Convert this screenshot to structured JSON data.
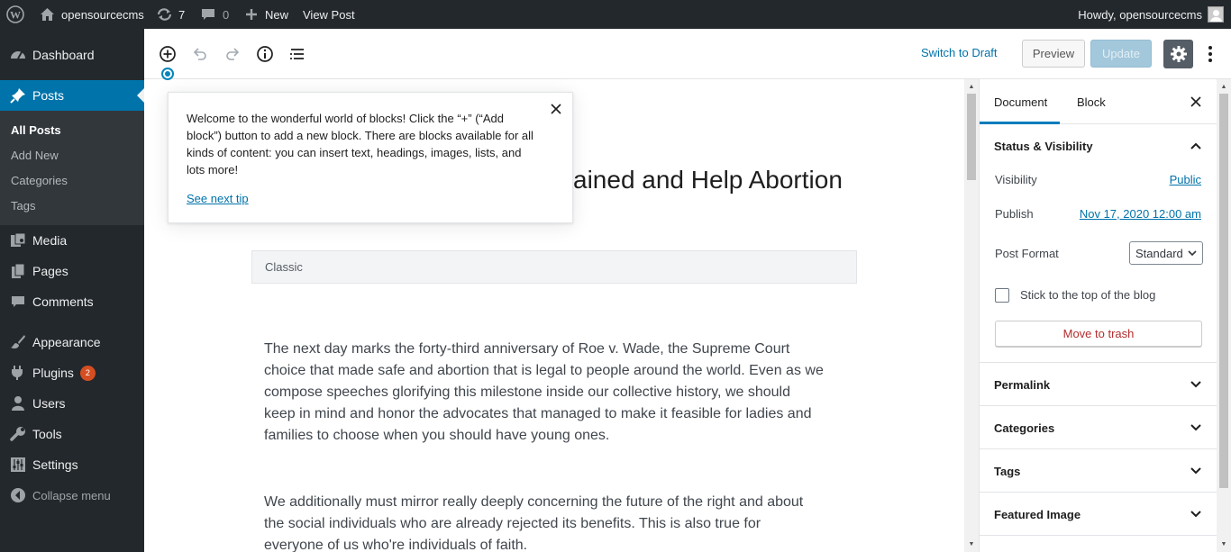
{
  "admin_bar": {
    "site_name": "opensourcecms",
    "updates_count": "7",
    "comments_count": "0",
    "new_label": "New",
    "view_post_label": "View Post",
    "howdy": "Howdy, opensourcecms"
  },
  "menu": {
    "dashboard": "Dashboard",
    "posts": "Posts",
    "all_posts": "All Posts",
    "add_new": "Add New",
    "categories": "Categories",
    "tags": "Tags",
    "media": "Media",
    "pages": "Pages",
    "comments": "Comments",
    "appearance": "Appearance",
    "plugins": "Plugins",
    "plugins_badge": "2",
    "users": "Users",
    "tools": "Tools",
    "settings": "Settings",
    "collapse": "Collapse menu"
  },
  "toolbar": {
    "switch_to_draft": "Switch to Draft",
    "preview": "Preview",
    "update": "Update"
  },
  "tip": {
    "lines": [
      "Welcome to the wonderful world of blocks! Click the “+” (“Add",
      "block”) button to add a new block. There are blocks available for all",
      "kinds of content: you can insert text, headings, images, lists, and",
      "lots more!"
    ],
    "next_link": "See next tip"
  },
  "editor": {
    "title_visible": "ained and Help Abortion",
    "classic_label": "Classic",
    "paragraph1": [
      "The next day marks the forty-third anniversary of Roe v. Wade, the Supreme Court",
      "choice that made safe and abortion that is legal to people around the world. Even as we",
      "compose speeches glorifying this milestone inside our collective history, we should",
      "keep in mind and honor the advocates that managed to make it feasible for ladies and",
      "families to choose when you should have young ones."
    ],
    "paragraph2": [
      "We additionally must mirror really deeply concerning the future of the right and about",
      "the social individuals who are already rejected its benefits. This is also true for",
      "everyone of us who're individuals of faith."
    ]
  },
  "sidebar": {
    "tab_document": "Document",
    "tab_block": "Block",
    "status_visibility": "Status & Visibility",
    "visibility_label": "Visibility",
    "visibility_value": "Public",
    "publish_label": "Publish",
    "publish_value": "Nov 17, 2020 12:00 am",
    "post_format_label": "Post Format",
    "post_format_value": "Standard",
    "stick_label": "Stick to the top of the blog",
    "trash_label": "Move to trash",
    "permalink": "Permalink",
    "categories": "Categories",
    "tags": "Tags",
    "featured_image": "Featured Image"
  },
  "colors": {
    "admin_dark": "#23282d",
    "wp_blue": "#0073aa",
    "trash_red": "#b32d2e",
    "badge_orange": "#d54e21"
  }
}
